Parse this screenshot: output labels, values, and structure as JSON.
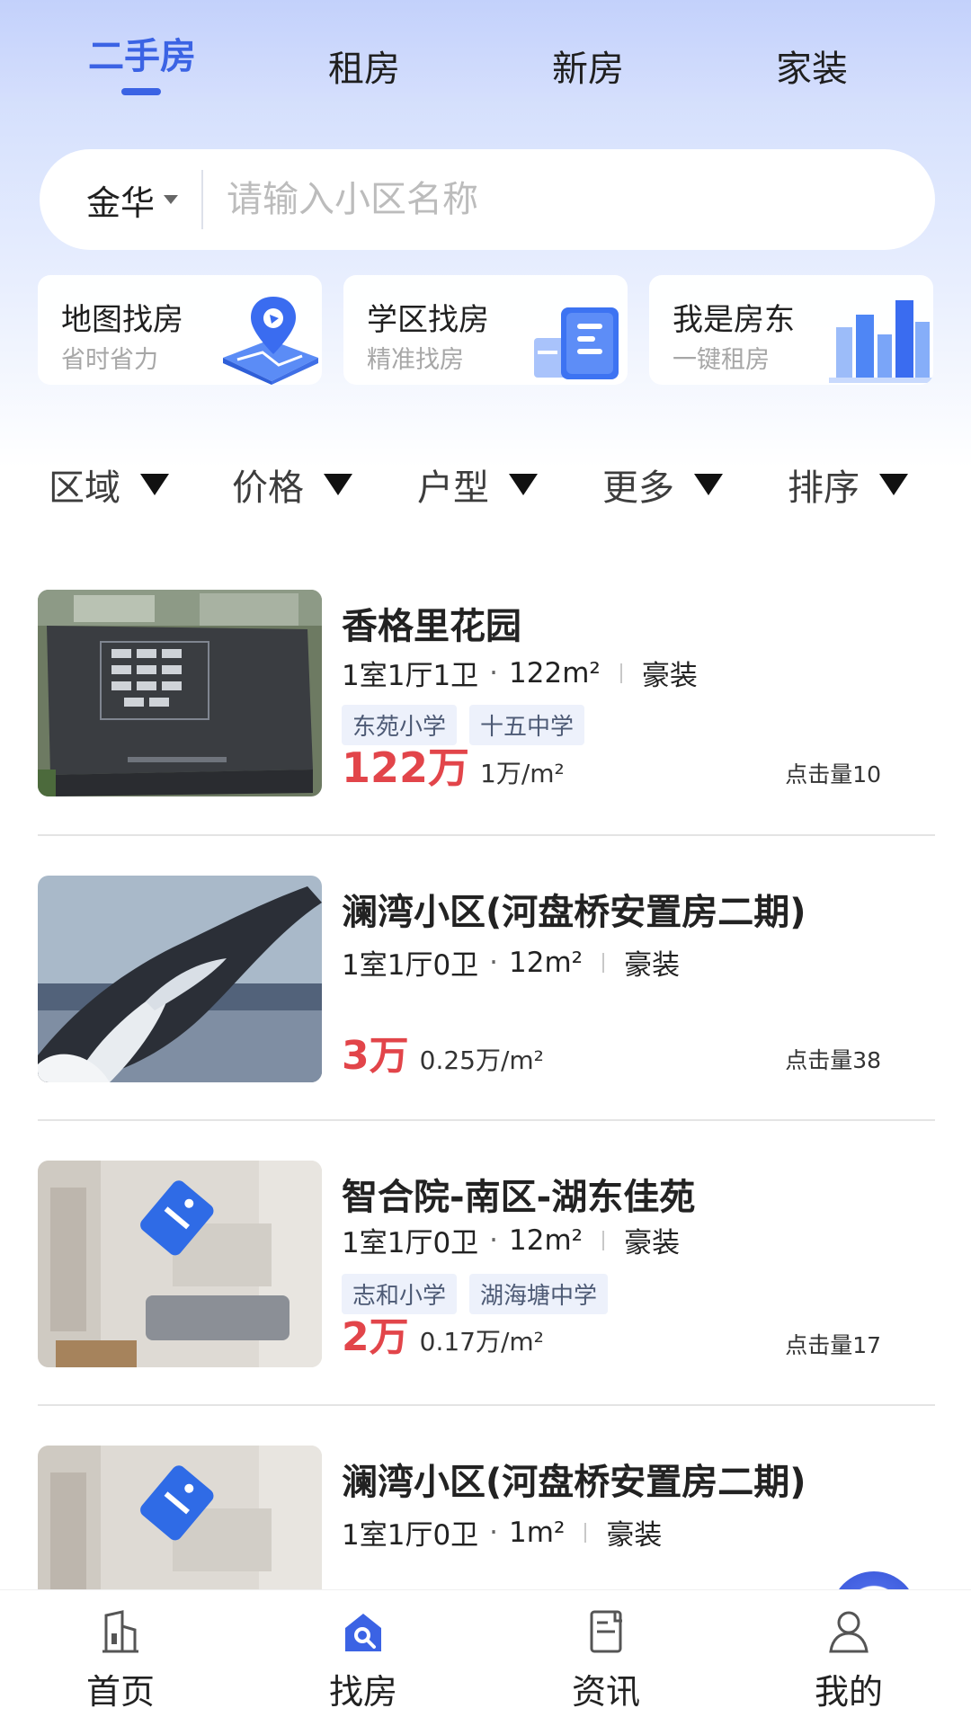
{
  "tabs": [
    {
      "label": "二手房",
      "active": true
    },
    {
      "label": "租房",
      "active": false
    },
    {
      "label": "新房",
      "active": false
    },
    {
      "label": "家装",
      "active": false
    }
  ],
  "search": {
    "city": "金华",
    "placeholder": "请输入小区名称"
  },
  "shortcuts": [
    {
      "title": "地图找房",
      "subtitle": "省时省力",
      "icon": "map-location-icon"
    },
    {
      "title": "学区找房",
      "subtitle": "精准找房",
      "icon": "school-building-icon"
    },
    {
      "title": "我是房东",
      "subtitle": "一键租房",
      "icon": "city-buildings-icon"
    }
  ],
  "filters": [
    {
      "label": "区域"
    },
    {
      "label": "价格"
    },
    {
      "label": "户型"
    },
    {
      "label": "更多"
    },
    {
      "label": "排序"
    }
  ],
  "listings": [
    {
      "title": "香格里花园",
      "layout": "1室1厅1卫",
      "area": "122m²",
      "decor": "豪装",
      "tags": [
        "东苑小学",
        "十五中学"
      ],
      "price": "122万",
      "unit_price": "1万/m²",
      "clicks": "点击量10",
      "photo": "building-model-photo"
    },
    {
      "title": "澜湾小区(河盘桥安置房二期)",
      "layout": "1室1厅0卫",
      "area": "12m²",
      "decor": "豪装",
      "tags": [],
      "price": "3万",
      "unit_price": "0.25万/m²",
      "clicks": "点击量38",
      "photo": "whale-photo"
    },
    {
      "title": "智合院-南区-湖东佳苑",
      "layout": "1室1厅0卫",
      "area": "12m²",
      "decor": "豪装",
      "tags": [
        "志和小学",
        "湖海塘中学"
      ],
      "price": "2万",
      "unit_price": "0.17万/m²",
      "clicks": "点击量17",
      "photo": "blurred-room-photo"
    },
    {
      "title": "澜湾小区(河盘桥安置房二期)",
      "layout": "1室1厅0卫",
      "area": "1m²",
      "decor": "豪装",
      "tags": [],
      "photo": "blurred-room-photo"
    }
  ],
  "bottom_nav": [
    {
      "label": "首页",
      "icon": "home-icon",
      "active": false
    },
    {
      "label": "找房",
      "icon": "house-search-icon",
      "active": true
    },
    {
      "label": "资讯",
      "icon": "news-icon",
      "active": false
    },
    {
      "label": "我的",
      "icon": "user-icon",
      "active": false
    }
  ],
  "colors": {
    "accent": "#3b63e4",
    "price": "#e2454a",
    "tag_bg": "#edf1fb"
  }
}
